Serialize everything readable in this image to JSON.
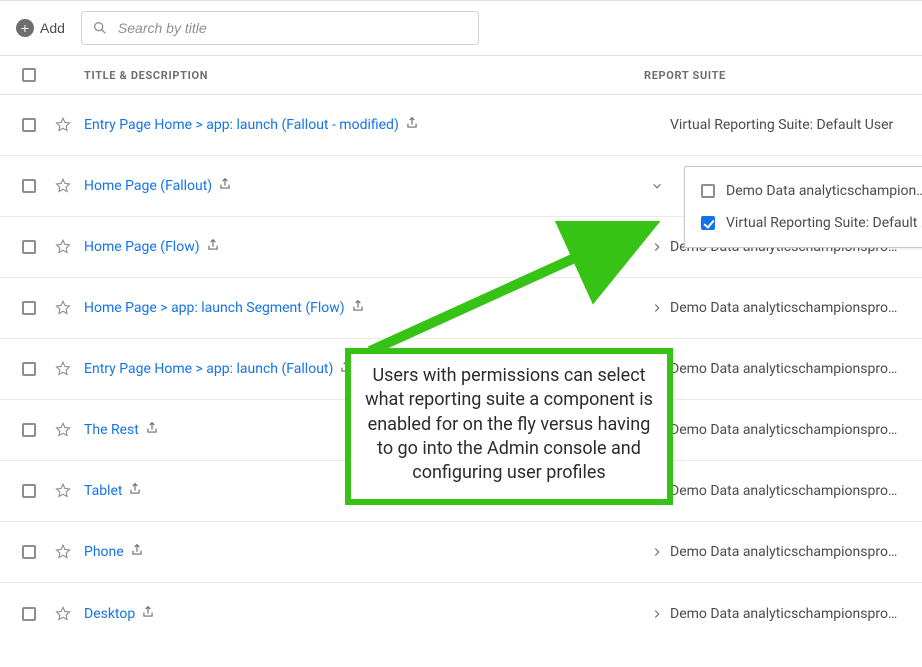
{
  "toolbar": {
    "add_label": "Add",
    "search_placeholder": "Search by title"
  },
  "headers": {
    "title": "TITLE & DESCRIPTION",
    "report_suite": "REPORT SUITE"
  },
  "rows": [
    {
      "title": "Entry Page Home > app: launch (Fallout - modified)",
      "suite": "Virtual Reporting Suite: Default User",
      "caret": "none"
    },
    {
      "title": "Home Page (Fallout)",
      "suite": "",
      "caret": "down"
    },
    {
      "title": "Home Page (Flow)",
      "suite": "Demo Data analyticschampionsprogram",
      "caret": "right"
    },
    {
      "title": "Home Page > app: launch Segment (Flow)",
      "suite": "Demo Data analyticschampionsprogram",
      "caret": "right"
    },
    {
      "title": "Entry Page Home > app: launch (Fallout)",
      "suite": "Demo Data analyticschampionsprogram",
      "caret": "right"
    },
    {
      "title": "The Rest",
      "suite": "Demo Data analyticschampionsprogram",
      "caret": "right"
    },
    {
      "title": "Tablet",
      "suite": "Demo Data analyticschampionsprogram",
      "caret": "right"
    },
    {
      "title": "Phone",
      "suite": "Demo Data analyticschampionsprogram",
      "caret": "right"
    },
    {
      "title": "Desktop",
      "suite": "Demo Data analyticschampionsprogram",
      "caret": "right"
    }
  ],
  "popup": {
    "items": [
      {
        "label": "Demo Data analyticschampionsprogr",
        "checked": false
      },
      {
        "label": "Virtual Reporting Suite: Default User",
        "checked": true
      }
    ]
  },
  "annotation": {
    "text": "Users with permissions can select what reporting suite a component is enabled for on the fly versus having to go into the Admin console and configuring user profiles"
  }
}
